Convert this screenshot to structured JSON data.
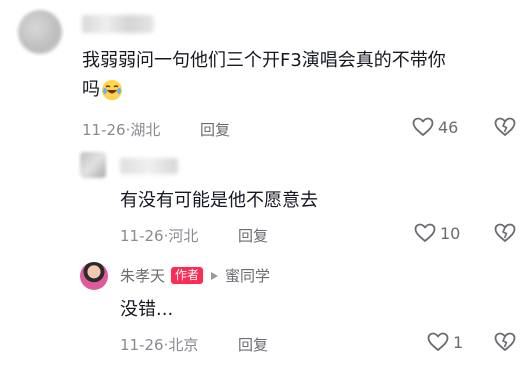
{
  "comments": [
    {
      "text": "我弱弱问一句他们三个开F3演唱会真的不带你",
      "text_line2": "吗",
      "emoji": "rolling-on-floor-laughing",
      "date": "11-26",
      "location": "湖北",
      "reply_label": "回复",
      "likes": "46"
    },
    {
      "text": "有没有可能是他不愿意去",
      "date": "11-26",
      "location": "河北",
      "reply_label": "回复",
      "likes": "10"
    },
    {
      "author_name": "朱孝天",
      "author_badge": "作者",
      "reply_to": "蜜同学",
      "text": "没错...",
      "date": "11-26",
      "location": "北京",
      "reply_label": "回复",
      "likes": "1"
    }
  ],
  "meta_separator": "·",
  "colors": {
    "text": "#161823",
    "meta": "#8a8b91",
    "badge": "#fe2c55"
  },
  "icons": [
    "heart-icon",
    "dislike-icon",
    "play-triangle-icon"
  ]
}
